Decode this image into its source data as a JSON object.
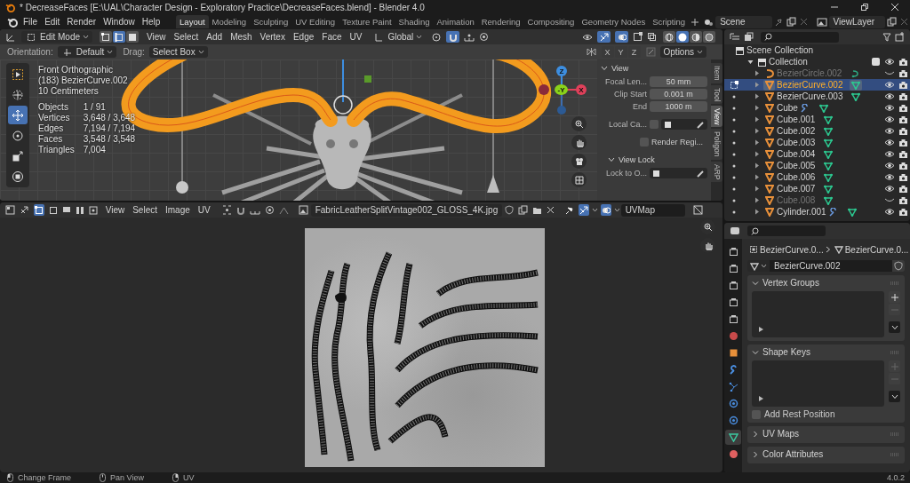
{
  "window": {
    "title": "* DecreaseFaces [E:\\UAL\\Character Design - Exploratory Practice\\DecreaseFaces.blend] - Blender 4.0"
  },
  "menu": [
    "File",
    "Edit",
    "Render",
    "Window",
    "Help"
  ],
  "workspaces": [
    {
      "label": "Layout",
      "selected": true
    },
    {
      "label": "Modeling",
      "selected": false
    },
    {
      "label": "Sculpting",
      "selected": false
    },
    {
      "label": "UV Editing",
      "selected": false
    },
    {
      "label": "Texture Paint",
      "selected": false
    },
    {
      "label": "Shading",
      "selected": false
    },
    {
      "label": "Animation",
      "selected": false
    },
    {
      "label": "Rendering",
      "selected": false
    },
    {
      "label": "Compositing",
      "selected": false
    },
    {
      "label": "Geometry Nodes",
      "selected": false
    },
    {
      "label": "Scripting",
      "selected": false
    }
  ],
  "scene": "Scene",
  "view_layer": "ViewLayer",
  "viewport": {
    "mode": "Edit Mode",
    "select_modes": [
      {
        "kind": "vertex",
        "selected": false
      },
      {
        "kind": "edge",
        "selected": true
      },
      {
        "kind": "face",
        "selected": false
      }
    ],
    "menus": [
      "View",
      "Select",
      "Add",
      "Mesh",
      "Vertex",
      "Edge",
      "Face",
      "UV"
    ],
    "transform": "Global",
    "shading": [
      {
        "kind": "wire",
        "selected": false
      },
      {
        "kind": "solid",
        "selected": true
      },
      {
        "kind": "material",
        "selected": false
      },
      {
        "kind": "render",
        "selected": false
      }
    ],
    "orientation_label": "Orientation:",
    "orientation": "Default",
    "drag_label": "Drag:",
    "drag": "Select Box",
    "axes": [
      "X",
      "Y",
      "Z"
    ],
    "options": "Options",
    "info": [
      "Front Orthographic",
      "(183) BezierCurve.002",
      "10 Centimeters"
    ],
    "stats": [
      {
        "label": "Objects",
        "value": "1 / 91"
      },
      {
        "label": "Vertices",
        "value": "3,648 / 3,648"
      },
      {
        "label": "Edges",
        "value": "7,194 / 7,194"
      },
      {
        "label": "Faces",
        "value": "3,548 / 3,548"
      },
      {
        "label": "Triangles",
        "value": "7,004"
      }
    ],
    "gizmo": {
      "z": "Z",
      "y": "-Y",
      "x": "X"
    },
    "tools": [
      {
        "kind": "select",
        "selected": false
      },
      {
        "kind": "cursor",
        "selected": false
      },
      {
        "kind": "move",
        "selected": true
      },
      {
        "kind": "rotate",
        "selected": false
      },
      {
        "kind": "scale",
        "selected": false
      },
      {
        "kind": "transform",
        "selected": false
      }
    ]
  },
  "sidebar": {
    "tabs": [
      {
        "label": "Item",
        "selected": false
      },
      {
        "label": "Tool",
        "selected": false
      },
      {
        "label": "View",
        "selected": true
      },
      {
        "label": "Poligon",
        "selected": false
      },
      {
        "label": "ARP",
        "selected": false
      }
    ],
    "section": "View",
    "fields": [
      {
        "label": "Focal Len...",
        "value": "50 mm"
      },
      {
        "label": "Clip Start",
        "value": "0.001 m"
      },
      {
        "label": "End",
        "value": "1000 m"
      }
    ],
    "local_camera": {
      "label": "Local Ca...",
      "checked": false
    },
    "render_region": {
      "label": "Render Regi...",
      "checked": false
    },
    "view_lock": "View Lock",
    "lock_to": "Lock to O..."
  },
  "uv_editor": {
    "menus": [
      "View",
      "Select",
      "Image",
      "UV"
    ],
    "image": "FabricLeatherSplitVintage002_GLOSS_4K.jpg",
    "uv_map": "UVMap"
  },
  "outliner": {
    "root": "Scene Collection",
    "collection": {
      "name": "Collection",
      "checked": true
    },
    "items": [
      {
        "name": "BezierCircle.002",
        "kind": "curve",
        "selected": false,
        "hidden": true,
        "modifier": false,
        "editable": false
      },
      {
        "name": "BezierCurve.002",
        "kind": "mesh",
        "selected": true,
        "hidden": false,
        "modifier": false,
        "editable": true,
        "in_edit_mode": true
      },
      {
        "name": "BezierCurve.003",
        "kind": "mesh",
        "selected": false,
        "hidden": false,
        "modifier": false,
        "editable": true,
        "in_edit_mode": false
      },
      {
        "name": "Cube",
        "kind": "mesh",
        "selected": false,
        "hidden": false,
        "modifier": true,
        "editable": true,
        "in_edit_mode": false
      },
      {
        "name": "Cube.001",
        "kind": "mesh",
        "selected": false,
        "hidden": false,
        "modifier": false,
        "editable": true,
        "in_edit_mode": false
      },
      {
        "name": "Cube.002",
        "kind": "mesh",
        "selected": false,
        "hidden": false,
        "modifier": false,
        "editable": true,
        "in_edit_mode": false
      },
      {
        "name": "Cube.003",
        "kind": "mesh",
        "selected": false,
        "hidden": false,
        "modifier": false,
        "editable": true,
        "in_edit_mode": false
      },
      {
        "name": "Cube.004",
        "kind": "mesh",
        "selected": false,
        "hidden": false,
        "modifier": false,
        "editable": true,
        "in_edit_mode": false
      },
      {
        "name": "Cube.005",
        "kind": "mesh",
        "selected": false,
        "hidden": false,
        "modifier": false,
        "editable": true,
        "in_edit_mode": false
      },
      {
        "name": "Cube.006",
        "kind": "mesh",
        "selected": false,
        "hidden": false,
        "modifier": false,
        "editable": true,
        "in_edit_mode": false
      },
      {
        "name": "Cube.007",
        "kind": "mesh",
        "selected": false,
        "hidden": false,
        "modifier": false,
        "editable": true,
        "in_edit_mode": false
      },
      {
        "name": "Cube.008",
        "kind": "mesh",
        "selected": false,
        "hidden": true,
        "modifier": false,
        "editable": true,
        "in_edit_mode": false
      },
      {
        "name": "Cylinder.001",
        "kind": "mesh",
        "selected": false,
        "hidden": false,
        "modifier": true,
        "editable": true,
        "in_edit_mode": false
      }
    ]
  },
  "properties": {
    "tabs": [
      {
        "kind": "tool",
        "selected": false
      },
      {
        "kind": "render",
        "selected": false
      },
      {
        "kind": "output",
        "selected": false
      },
      {
        "kind": "view_layer",
        "selected": false
      },
      {
        "kind": "scene",
        "selected": false
      },
      {
        "kind": "world",
        "selected": false
      },
      {
        "kind": "object",
        "selected": false
      },
      {
        "kind": "modifiers",
        "selected": false
      },
      {
        "kind": "particles",
        "selected": false
      },
      {
        "kind": "physics",
        "selected": false
      },
      {
        "kind": "constraints",
        "selected": false
      },
      {
        "kind": "data",
        "selected": true
      },
      {
        "kind": "material",
        "selected": false
      }
    ],
    "breadcrumb": [
      "BezierCurve.0...",
      "BezierCurve.0..."
    ],
    "data_name": "BezierCurve.002",
    "panels": [
      {
        "title": "Vertex Groups",
        "expanded": true
      },
      {
        "title": "Shape Keys",
        "expanded": true,
        "option": {
          "label": "Add Rest Position",
          "checked": false
        }
      },
      {
        "title": "UV Maps",
        "expanded": false
      },
      {
        "title": "Color Attributes",
        "expanded": false
      }
    ]
  },
  "status_bar": {
    "hints": [
      {
        "kind": "left",
        "label": "Change Frame"
      },
      {
        "kind": "middle",
        "label": "Pan View"
      },
      {
        "kind": "right",
        "label": "UV"
      }
    ],
    "version": "4.0.2"
  }
}
